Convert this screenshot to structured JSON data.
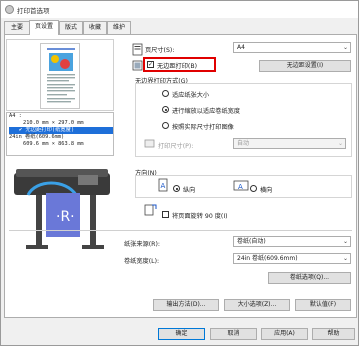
{
  "window": {
    "title": "打印首选项"
  },
  "tabs": [
    {
      "label": "主要"
    },
    {
      "label": "页设置"
    },
    {
      "label": "版式"
    },
    {
      "label": "收藏"
    },
    {
      "label": "维护"
    }
  ],
  "info_box": {
    "line1": "A4 :",
    "line2": "210.0 mm × 297.0 mm",
    "line3": "无边距打印(纸宽度)",
    "line4": "24in 卷纸(609.6mm)",
    "line5": "609.6 mm × 863.8 mm"
  },
  "page_size": {
    "label": "页尺寸(S):",
    "value": "A4"
  },
  "borderless": {
    "label": "无边距打印(B)",
    "checked": true
  },
  "borderless_settings_button": "无边距设置(I)",
  "borderless_method": {
    "title": "无边界打印方式(G)",
    "options": [
      {
        "label": "适应纸张大小",
        "selected": false
      },
      {
        "label": "进行缩放以适应卷纸宽度",
        "selected": true
      },
      {
        "label": "按照实际尺寸打印图像",
        "selected": false
      }
    ],
    "print_size_label": "打印尺寸(P):",
    "print_size_value": "自动"
  },
  "orientation": {
    "title": "方向(N)",
    "portrait_label": "纵向",
    "landscape_label": "横向",
    "selected": "portrait"
  },
  "rotate": {
    "label": "将页面旋转 90 度(I)",
    "checked": false
  },
  "paper_source": {
    "label": "纸张来源(R):",
    "value": "卷纸(自动)"
  },
  "roll_width": {
    "label": "卷纸宽度(L):",
    "value": "24in 卷纸(609.6mm)"
  },
  "roll_options_button": "卷纸选项(Q)...",
  "mid_buttons": [
    "输出方法(D)...",
    "大小选项(Z)...",
    "默认值(F)"
  ],
  "bottom_buttons": [
    "确定",
    "取消",
    "应用(A)",
    "帮助"
  ],
  "colors": {
    "accent": "#0078d7",
    "highlight": "#e00000",
    "selection": "#1e6fd9"
  }
}
